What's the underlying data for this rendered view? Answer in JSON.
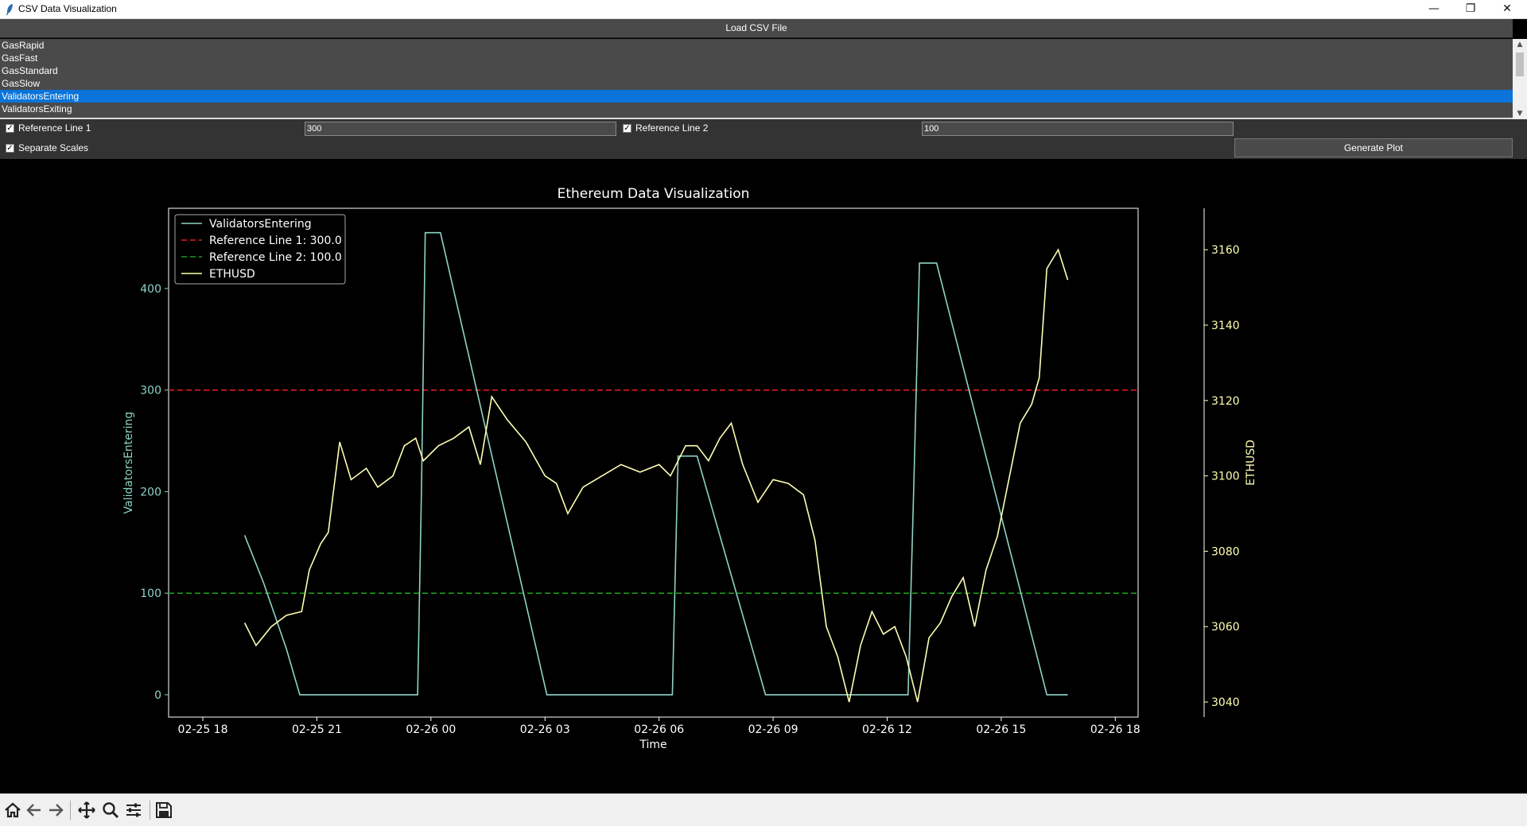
{
  "window": {
    "title": "CSV Data Visualization",
    "controls": {
      "minimize": "—",
      "restore": "❐",
      "close": "✕"
    }
  },
  "load_button": {
    "label": "Load CSV File"
  },
  "column_list": {
    "items": [
      "GasRapid",
      "GasFast",
      "GasStandard",
      "GasSlow",
      "ValidatorsEntering",
      "ValidatorsExiting"
    ],
    "selected": "ValidatorsEntering"
  },
  "options": {
    "ref_line_1": {
      "label": "Reference Line 1",
      "checked": true,
      "value": "300"
    },
    "ref_line_2": {
      "label": "Reference Line 2",
      "checked": true,
      "value": "100"
    },
    "separate_scales": {
      "label": "Separate Scales",
      "checked": true
    }
  },
  "generate_button": {
    "label": "Generate Plot"
  },
  "chart_data": {
    "type": "line",
    "title": "Ethereum Data Visualization",
    "xlabel": "Time",
    "ylabel_left": "ValidatorsEntering",
    "ylabel_right": "ETHUSD",
    "x_ticks": [
      "02-25 18",
      "02-25 21",
      "02-26 00",
      "02-26 03",
      "02-26 06",
      "02-26 09",
      "02-26 12",
      "02-26 15",
      "02-26 18"
    ],
    "y_left_ticks": [
      0,
      100,
      200,
      300,
      400
    ],
    "y_right_ticks": [
      3040,
      3060,
      3080,
      3100,
      3120,
      3140,
      3160
    ],
    "xlim_hours_from": "02-25 18",
    "ylim_left": [
      -22,
      479
    ],
    "ylim_right": [
      3036,
      3171
    ],
    "legend_position": "top-left",
    "colors": {
      "validators": "#8dd3c7",
      "ethusd": "#ffffb3",
      "ref1": "#e41a1c",
      "ref2": "#1a9a1a",
      "text": "#ffffff",
      "axis_left": "#8dd3c7",
      "axis_right": "#ffffb3"
    },
    "reference_lines": [
      {
        "name": "Reference Line 1: 300.0",
        "value": 300,
        "color": "#e41a1c"
      },
      {
        "name": "Reference Line 2: 100.0",
        "value": 100,
        "color": "#1a9a1a"
      }
    ],
    "series": [
      {
        "name": "ValidatorsEntering",
        "axis": "left",
        "points": [
          [
            1.1,
            157
          ],
          [
            1.6,
            110
          ],
          [
            2.2,
            45
          ],
          [
            2.55,
            0
          ],
          [
            5.65,
            0
          ],
          [
            5.75,
            200
          ],
          [
            5.85,
            455
          ],
          [
            6.25,
            455
          ],
          [
            9.05,
            0
          ],
          [
            12.35,
            0
          ],
          [
            12.5,
            235
          ],
          [
            13.0,
            235
          ],
          [
            14.8,
            0
          ],
          [
            18.55,
            0
          ],
          [
            18.7,
            205
          ],
          [
            18.85,
            425
          ],
          [
            19.3,
            425
          ],
          [
            22.2,
            0
          ],
          [
            22.75,
            0
          ]
        ]
      },
      {
        "name": "ETHUSD",
        "axis": "right",
        "points": [
          [
            1.1,
            3061
          ],
          [
            1.4,
            3055
          ],
          [
            1.8,
            3060
          ],
          [
            2.2,
            3063
          ],
          [
            2.6,
            3064
          ],
          [
            2.8,
            3075
          ],
          [
            3.1,
            3082
          ],
          [
            3.3,
            3085
          ],
          [
            3.6,
            3109
          ],
          [
            3.9,
            3099
          ],
          [
            4.3,
            3102
          ],
          [
            4.6,
            3097
          ],
          [
            5.0,
            3100
          ],
          [
            5.3,
            3108
          ],
          [
            5.6,
            3110
          ],
          [
            5.8,
            3104
          ],
          [
            6.2,
            3108
          ],
          [
            6.6,
            3110
          ],
          [
            7.0,
            3113
          ],
          [
            7.3,
            3103
          ],
          [
            7.6,
            3121
          ],
          [
            8.0,
            3115
          ],
          [
            8.5,
            3109
          ],
          [
            9.0,
            3100
          ],
          [
            9.3,
            3098
          ],
          [
            9.6,
            3090
          ],
          [
            10.0,
            3097
          ],
          [
            10.5,
            3100
          ],
          [
            11.0,
            3103
          ],
          [
            11.5,
            3101
          ],
          [
            12.0,
            3103
          ],
          [
            12.3,
            3100
          ],
          [
            12.7,
            3108
          ],
          [
            13.0,
            3108
          ],
          [
            13.3,
            3104
          ],
          [
            13.6,
            3110
          ],
          [
            13.9,
            3114
          ],
          [
            14.2,
            3103
          ],
          [
            14.6,
            3093
          ],
          [
            15.0,
            3099
          ],
          [
            15.4,
            3098
          ],
          [
            15.8,
            3095
          ],
          [
            16.1,
            3083
          ],
          [
            16.4,
            3060
          ],
          [
            16.7,
            3052
          ],
          [
            17.0,
            3040
          ],
          [
            17.3,
            3055
          ],
          [
            17.6,
            3064
          ],
          [
            17.9,
            3058
          ],
          [
            18.2,
            3060
          ],
          [
            18.5,
            3052
          ],
          [
            18.8,
            3040
          ],
          [
            19.1,
            3057
          ],
          [
            19.4,
            3061
          ],
          [
            19.7,
            3068
          ],
          [
            20.0,
            3073
          ],
          [
            20.3,
            3060
          ],
          [
            20.6,
            3075
          ],
          [
            20.9,
            3084
          ],
          [
            21.2,
            3099
          ],
          [
            21.5,
            3114
          ],
          [
            21.8,
            3119
          ],
          [
            22.0,
            3126
          ],
          [
            22.2,
            3155
          ],
          [
            22.5,
            3160
          ],
          [
            22.75,
            3152
          ]
        ]
      }
    ]
  },
  "toolbar": {
    "icons": [
      "home-icon",
      "back-icon",
      "forward-icon",
      "pan-icon",
      "zoom-icon",
      "configure-icon",
      "save-icon"
    ]
  }
}
